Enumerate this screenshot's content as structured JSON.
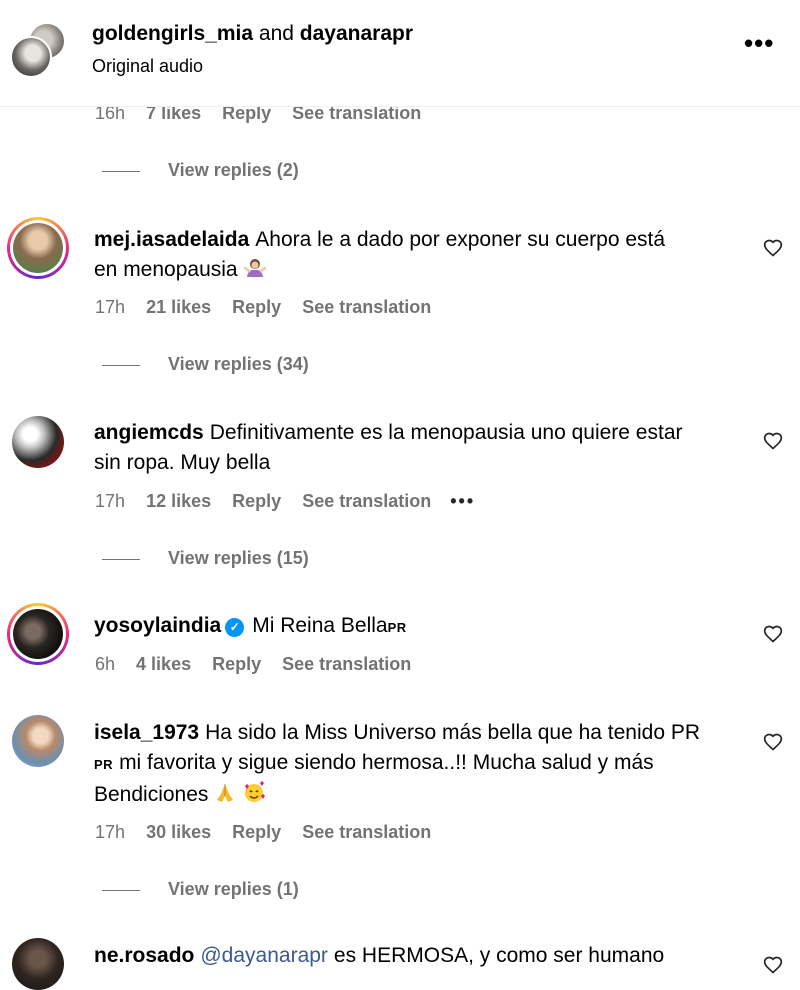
{
  "header": {
    "user1": "goldengirls_mia",
    "conj": "and",
    "user2": "dayanarapr",
    "subtitle": "Original audio",
    "more_icon": "more-horizontal-icon"
  },
  "top": {
    "time": "16h",
    "likes": "7 likes",
    "reply": "Reply",
    "translate": "See translation",
    "view_replies": "View replies (2)"
  },
  "comments": [
    {
      "username": "mej.iasadelaida",
      "line1": "Ahora le a dado por exponer su cuerpo está",
      "line2": "en menopausia",
      "emoji": "person-shrugging-emoji",
      "time": "17h",
      "likes": "21 likes",
      "reply": "Reply",
      "translate": "See translation",
      "view_replies": "View replies (34)"
    },
    {
      "username": "angiemcds",
      "line1": "Definitivamente es la menopausia uno quiere estar",
      "line2": "sin ropa. Muy bella",
      "time": "17h",
      "likes": "12 likes",
      "reply": "Reply",
      "translate": "See translation",
      "more": "•••",
      "view_replies": "View replies (15)"
    },
    {
      "username": "yosoylaindia",
      "text": "Mi Reina Bella",
      "flag": "PR",
      "time": "6h",
      "likes": "4 likes",
      "reply": "Reply",
      "translate": "See translation"
    },
    {
      "username": "isela_1973",
      "line1": "Ha sido la Miss Universo más bella que ha tenido PR",
      "line2_flag": "PR",
      "line2": "mi favorita y sigue siendo hermosa..!! Mucha salud y más",
      "line3": "Bendiciones",
      "emojis": [
        "folded-hands-emoji",
        "smiling-face-with-hearts-emoji"
      ],
      "time": "17h",
      "likes": "30 likes",
      "reply": "Reply",
      "translate": "See translation",
      "view_replies": "View replies (1)"
    },
    {
      "username": "ne.rosado",
      "mention": "@dayanarapr",
      "text": "es HERMOSA, y como ser humano"
    }
  ],
  "colors": {
    "meta_gray": "#737373",
    "mention_blue": "#3b5a8f",
    "verified_blue": "#0095f6",
    "story_ring": [
      "#f9ce34",
      "#ee2a7b",
      "#6228d7"
    ]
  }
}
